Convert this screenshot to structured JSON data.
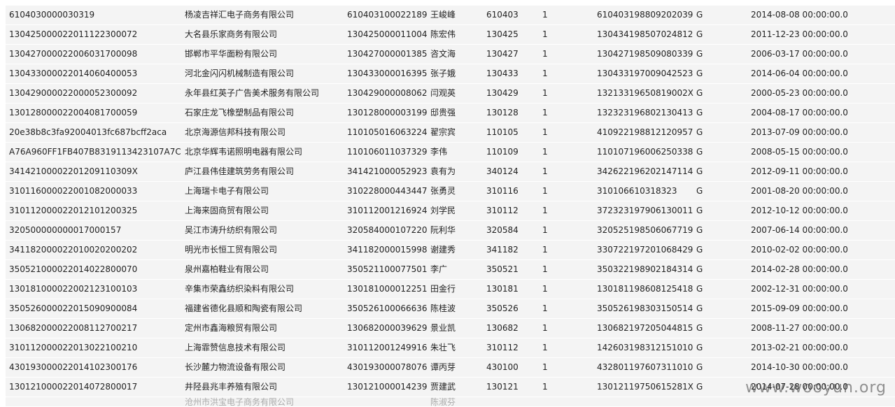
{
  "table": {
    "rows": [
      [
        "610403000003031​9",
        "杨凌吉祥汇电子商务有限公司",
        "610403100022189",
        "王峻峰",
        "610403",
        "1",
        "610403198809202039",
        "G",
        "2014-08-08 00:00:00.0"
      ],
      [
        "130425000022011122300072",
        "大名县乐家商务有限公司",
        "130425000011004",
        "陈宏伟",
        "130425",
        "1",
        "130434198507024812",
        "G",
        "2011-12-23 00:00:00.0"
      ],
      [
        "130427000022006031700098",
        "邯郸市平华面粉有限公司",
        "130427000001385",
        "咨文海",
        "130427",
        "1",
        "130427198509080339",
        "G",
        "2006-03-17 00:00:00.0"
      ],
      [
        "130433000022014060400053",
        "河北金闪闪机械制造有限公司",
        "130433000016395",
        "张子娥",
        "130433",
        "1",
        "130433197009042523",
        "G",
        "2014-06-04 00:00:00.0"
      ],
      [
        "130429000022000052300092",
        "永年县红英子广告美术服务有限公司",
        "130429000008062",
        "闫观英",
        "130429",
        "1",
        "13213319650819002X",
        "G",
        "2000-05-23 00:00:00.0"
      ],
      [
        "130128000022004081700059",
        "石家庄龙飞橡塑制品有限公司",
        "130128000003199",
        "邸贵强",
        "130128",
        "1",
        "132323196802130413",
        "G",
        "2004-08-17 00:00:00.0"
      ],
      [
        "20e38b8c3fa92004013fc687bcff2aca",
        "北京海源信邦科技有限公司",
        "110105016063224",
        "翟宗宾",
        "110105",
        "1",
        "410922198812120957",
        "G",
        "2013-07-09 00:00:00.0"
      ],
      [
        "A76A960FF1FB407B8319113423107A7C",
        "北京华辉韦诺照明电器有限公司",
        "110106011037329",
        "李伟",
        "110109",
        "1",
        "110107196006250338",
        "G",
        "2008-05-15 00:00:00.0"
      ],
      [
        "341421000022012091103​09X",
        "庐江县伟佳建筑劳务有限公司",
        "341421000052923",
        "袁有为",
        "340124",
        "1",
        "342622196202147114",
        "G",
        "2012-09-11 00:00:00.0"
      ],
      [
        "310116000022001082000033",
        "上海瑞卡电子有限公司",
        "310228000443447",
        "张勇灵",
        "310116",
        "1",
        "310106610318323",
        "G",
        "2001-08-20 00:00:00.0"
      ],
      [
        "310112000022012101200325",
        "上海来固商贸有限公司",
        "310112001216924",
        "刘学民",
        "310112",
        "1",
        "372323197906130011",
        "G",
        "2012-10-12 00:00:00.0"
      ],
      [
        "3205000000000170001​57",
        "吴江市涛升纺织有限公司",
        "320584000107220",
        "阮利华",
        "320584",
        "1",
        "320525198506067719",
        "G",
        "2007-06-14 00:00:00.0"
      ],
      [
        "341182000022010020200202",
        "明光市长恒工贸有限公司",
        "341182000015998",
        "谢建秀",
        "341182",
        "1",
        "330722197201068429",
        "G",
        "2010-02-02 00:00:00.0"
      ],
      [
        "350521000022014022800070",
        "泉州嘉柏鞋业有限公司",
        "350521100077501",
        "李广",
        "350521",
        "1",
        "350322198902184314",
        "G",
        "2014-02-28 00:00:00.0"
      ],
      [
        "130181000022002123100103",
        "辛集市荣鑫纺织染料有限公司",
        "130181000012251",
        "田金行",
        "130181",
        "1",
        "130181198608125418",
        "G",
        "2002-12-31 00:00:00.0"
      ],
      [
        "350526000022015090900084",
        "福建省德化县顺和陶瓷有限公司",
        "350526100066636",
        "陈桂波",
        "350526",
        "1",
        "350526198303150514",
        "G",
        "2015-09-09 00:00:00.0"
      ],
      [
        "130682000022008112700217",
        "定州市鑫海粮贸有限公司",
        "130682000039629",
        "景业凯",
        "130682",
        "1",
        "130682197205044815",
        "G",
        "2008-11-27 00:00:00.0"
      ],
      [
        "310112000022013022100210",
        "上海霏赞信息技术有限公司",
        "310112001249916",
        "朱壮飞",
        "310112",
        "1",
        "142603198312151010",
        "G",
        "2013-02-21 00:00:00.0"
      ],
      [
        "430193000022014102300176",
        "长沙麓力物流设备有限公司",
        "430193000078076",
        "谭丙芽",
        "430100",
        "1",
        "432801197607311010",
        "G",
        "2014-10-30 00:00:00.0"
      ],
      [
        "130121000022014072800017",
        "井陉县兆丰养殖有限公司",
        "130121000014239",
        "贾建武",
        "130121",
        "1",
        "13012119750615281X",
        "G",
        "2014-07-28 00:00:00.0"
      ]
    ],
    "partial_row": [
      "",
      "沧州市洪宝电子商务有限公司",
      "",
      "陈淑芬",
      "",
      "",
      "",
      "",
      ""
    ]
  },
  "watermark": "www.wooyun.org",
  "colors": {
    "row_bg": "#f4f4f4",
    "text": "#222222"
  }
}
